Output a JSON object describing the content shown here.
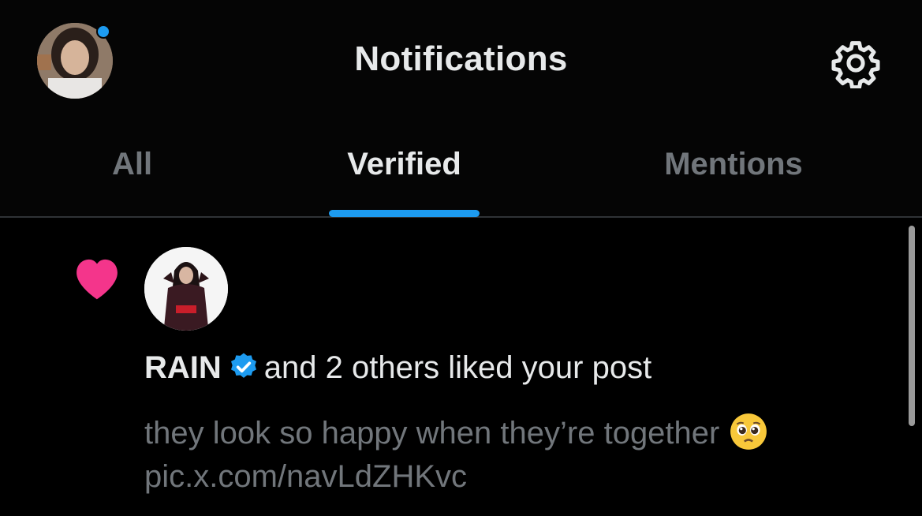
{
  "header": {
    "title": "Notifications",
    "avatar_icon": "user-avatar",
    "settings_icon": "gear-icon",
    "notification_dot_color": "#1d9bf0"
  },
  "tabs": [
    {
      "label": "All",
      "active": false
    },
    {
      "label": "Verified",
      "active": true
    },
    {
      "label": "Mentions",
      "active": false
    }
  ],
  "accent_color": "#1d9bf0",
  "notification": {
    "type_icon": "heart-icon",
    "heart_color": "#f4358b",
    "user_name": "RAIN",
    "verified_icon": "verified-badge-icon",
    "action_text": "and 2 others liked your post",
    "post_text": "they look so happy when they’re together",
    "emoji": "pleading-face-emoji",
    "post_link": "pic.x.com/navLdZHKvc"
  }
}
